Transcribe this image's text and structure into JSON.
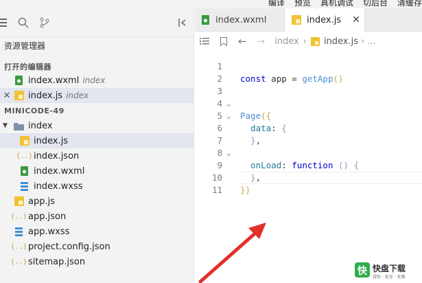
{
  "menubar": {
    "items": [
      "编译",
      "预览",
      "真机调试",
      "切后台",
      "清缓存"
    ]
  },
  "explorer": {
    "title": "资源管理器",
    "open_editors_header": "打开的编辑器",
    "open_editors": [
      {
        "name": "index.wxml",
        "sub": "index",
        "type": "wxml"
      },
      {
        "name": "index.js",
        "sub": "index",
        "type": "js",
        "selected": true
      }
    ],
    "project_header": "MINICODE-49",
    "folder": {
      "name": "index",
      "children": [
        {
          "name": "index.js",
          "type": "js",
          "selected": true
        },
        {
          "name": "index.json",
          "type": "json"
        },
        {
          "name": "index.wxml",
          "type": "wxml"
        },
        {
          "name": "index.wxss",
          "type": "wxss"
        }
      ]
    },
    "files": [
      {
        "name": "app.js",
        "type": "js"
      },
      {
        "name": "app.json",
        "type": "json"
      },
      {
        "name": "app.wxss",
        "type": "wxss"
      },
      {
        "name": "project.config.json",
        "type": "json"
      },
      {
        "name": "sitemap.json",
        "type": "json"
      }
    ]
  },
  "editor": {
    "tabs": [
      {
        "label": "index.wxml",
        "type": "wxml"
      },
      {
        "label": "index.js",
        "type": "js",
        "active": true
      }
    ],
    "breadcrumb": {
      "folder": "index",
      "file": "index.js",
      "more": "..."
    },
    "line_numbers": [
      "1",
      "2",
      "3",
      "4",
      "5",
      "6",
      "7",
      "8",
      "9",
      "10",
      "11"
    ]
  },
  "colors": {
    "js_icon": "#f1c232",
    "wxml_icon": "#3c9a3c",
    "json_icon": "#c9a64e",
    "wxss_icon": "#3f8fd6",
    "folder_icon": "#7f8fa8",
    "arrow": "#e2302a"
  },
  "watermark": {
    "brand": "快盘下载",
    "sub": "绿色 · 安全 · 无毒"
  }
}
